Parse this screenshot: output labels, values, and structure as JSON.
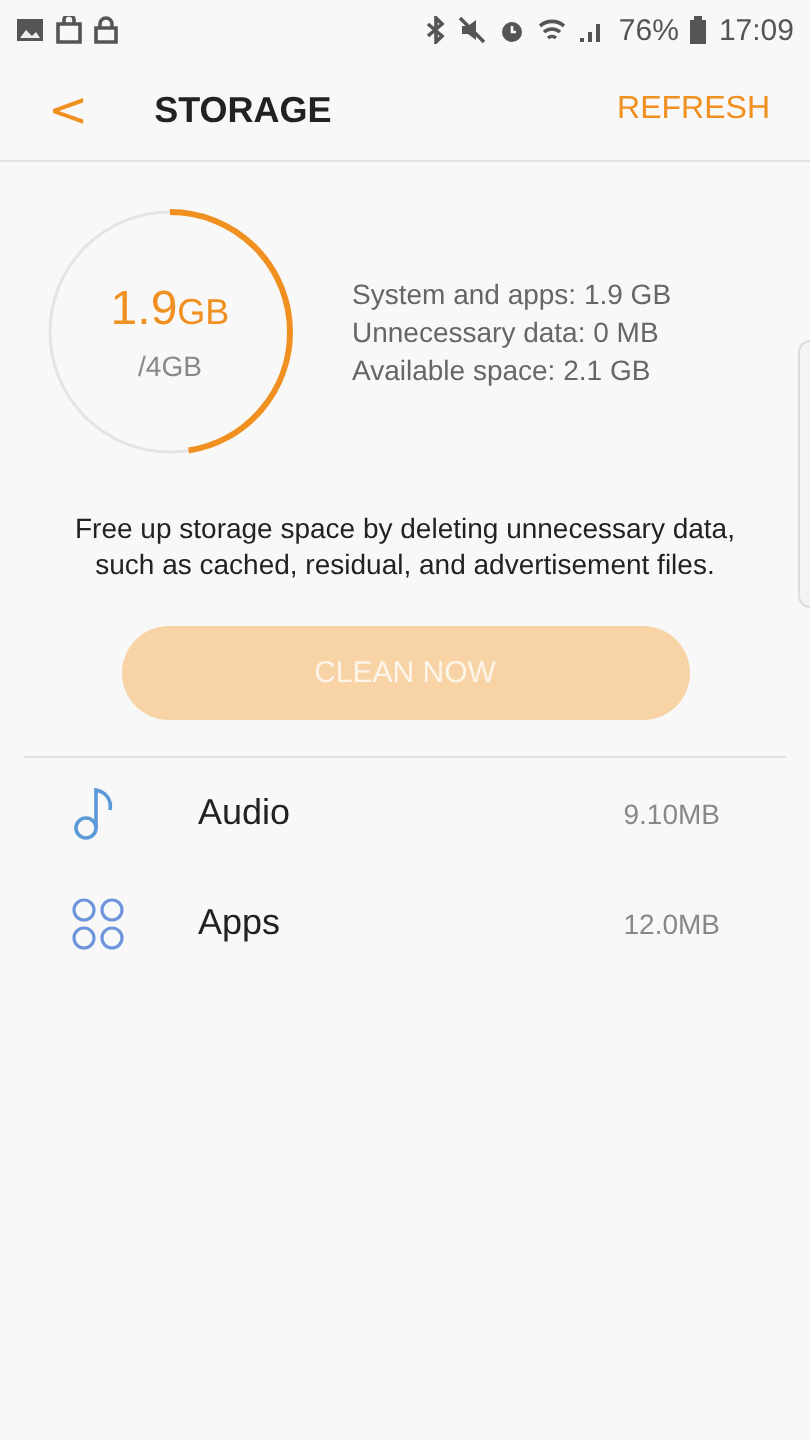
{
  "status_bar": {
    "battery": "76%",
    "time": "17:09"
  },
  "header": {
    "back": "<",
    "title": "STORAGE",
    "action": "REFRESH"
  },
  "gauge": {
    "used": "1.9",
    "used_unit": "GB",
    "total": "/4GB",
    "level": 0.475
  },
  "details": [
    "System and apps: 1.9 GB",
    "Unnecessary data: 0 MB",
    "Available space: 2.1 GB"
  ],
  "description": "Free up storage space by deleting unnecessary data, such as cached, residual, and advertisement files.",
  "clean_button": {
    "label": "CLEAN NOW",
    "disabled": true
  },
  "categories": [
    {
      "kind": "audio",
      "name": "Audio",
      "size": "9.10MB"
    },
    {
      "kind": "apps",
      "name": "Apps",
      "size": "12.0MB"
    }
  ]
}
